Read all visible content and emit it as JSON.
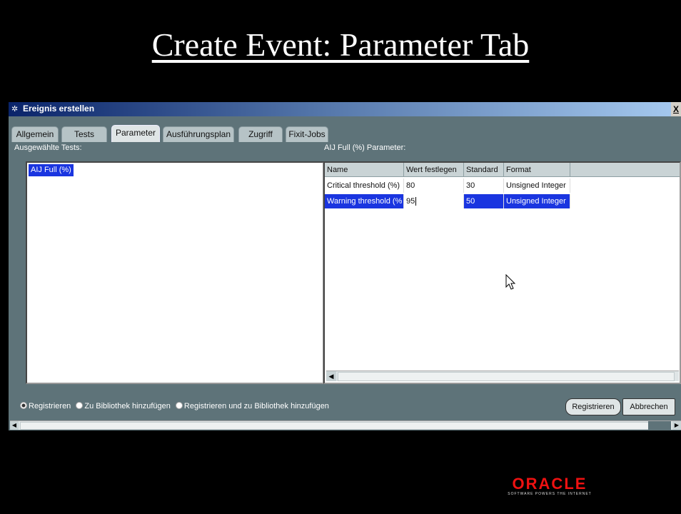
{
  "slide": {
    "title": "Create Event: Parameter Tab"
  },
  "window": {
    "title": "Ereignis erstellen",
    "close_label": "X"
  },
  "tabs": [
    {
      "label": "Allgemein"
    },
    {
      "label": "Tests"
    },
    {
      "label": "Parameter",
      "active": true
    },
    {
      "label": "Ausführungsplan"
    },
    {
      "label": "Zugriff"
    },
    {
      "label": "Fixit-Jobs"
    }
  ],
  "left_panel": {
    "label": "Ausgewählte Tests:",
    "items": [
      "AIJ Full (%)"
    ]
  },
  "right_panel": {
    "label": "AIJ Full (%) Parameter:",
    "columns": [
      "Name",
      "Wert festlegen",
      "Standard",
      "Format"
    ],
    "rows": [
      {
        "name": "Critical threshold (%)",
        "value": "80",
        "standard": "30",
        "format": "Unsigned Integer"
      },
      {
        "name": "Warning threshold (%",
        "value": "95",
        "standard": "50",
        "format": "Unsigned Integer"
      }
    ]
  },
  "radio_options": [
    {
      "label": "Registrieren",
      "selected": true
    },
    {
      "label": "Zu Bibliothek hinzufügen",
      "selected": false
    },
    {
      "label": "Registrieren und zu Bibliothek hinzufügen",
      "selected": false
    }
  ],
  "buttons": {
    "register": "Registrieren",
    "cancel": "Abbrechen"
  },
  "logo": {
    "word": "ORACLE",
    "tagline": "SOFTWARE POWERS THE INTERNET"
  },
  "colors": {
    "selection": "#1a35e0",
    "panel": "#5e7379",
    "logo": "#ee1111"
  }
}
